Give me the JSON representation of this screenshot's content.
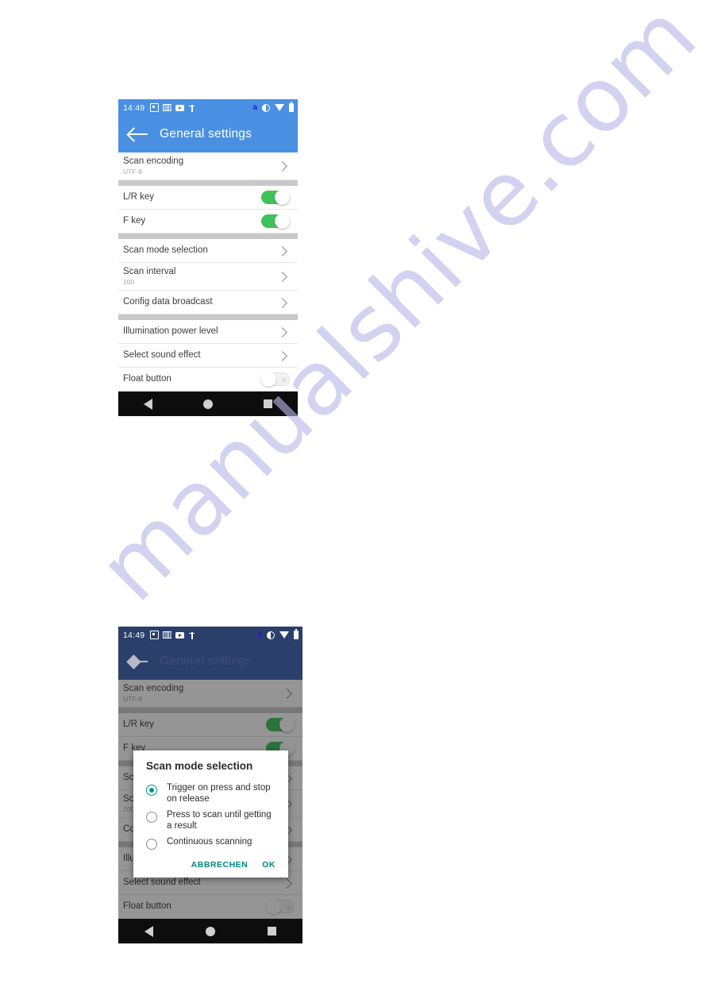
{
  "watermark": {
    "text": "manualshive.com"
  },
  "screens": [
    {
      "id": "general-settings",
      "status_bar": {
        "clock": "14:49",
        "left_icons": [
          "app-box-icon",
          "barcode-icon",
          "video-play-icon",
          "usb-icon"
        ],
        "right_icons": [
          "amazon-a-icon",
          "do-not-disturb-icon",
          "wifi-icon",
          "battery-icon"
        ]
      },
      "app_bar": {
        "back_icon": "back-arrow-icon",
        "title": "General settings"
      },
      "rows": [
        {
          "title": "Scan encoding",
          "subtitle": "UTF-8",
          "control": "chevron"
        },
        {
          "gap": true
        },
        {
          "title": "L/R key",
          "control": "toggle",
          "state": "on"
        },
        {
          "title": "F key",
          "control": "toggle",
          "state": "on"
        },
        {
          "gap": true
        },
        {
          "title": "Scan mode selection",
          "control": "chevron"
        },
        {
          "title": "Scan interval",
          "subtitle": "100",
          "control": "chevron"
        },
        {
          "title": "Config data broadcast",
          "control": "chevron"
        },
        {
          "gap": true
        },
        {
          "title": "Illumination power level",
          "control": "chevron"
        },
        {
          "title": "Select sound effect",
          "control": "chevron"
        },
        {
          "title": "Float button",
          "control": "toggle",
          "state": "off"
        }
      ],
      "nav_bar": [
        "back-triangle-icon",
        "home-circle-icon",
        "recents-square-icon"
      ]
    },
    {
      "id": "general-settings-with-dialog",
      "status_bar": {
        "clock": "14:49",
        "left_icons": [
          "app-box-icon",
          "barcode-icon",
          "video-play-icon",
          "usb-icon"
        ],
        "right_icons": [
          "amazon-a-icon",
          "do-not-disturb-icon",
          "wifi-icon",
          "battery-icon"
        ]
      },
      "app_bar": {
        "back_icon": "back-arrow-icon",
        "title": "General settings"
      },
      "rows": [
        {
          "title": "Scan encoding",
          "subtitle": "UTF-8",
          "control": "chevron"
        },
        {
          "gap": true
        },
        {
          "title": "L/R key",
          "control": "toggle",
          "state": "on"
        },
        {
          "title": "F key",
          "control": "toggle",
          "state": "on"
        },
        {
          "gap": true
        },
        {
          "title": "Scan mode selection",
          "control": "chevron"
        },
        {
          "title": "Scan interval",
          "subtitle": "100",
          "control": "chevron"
        },
        {
          "title": "Config data broadcast",
          "control": "chevron"
        },
        {
          "gap": true
        },
        {
          "title": "Illumination power level",
          "control": "chevron"
        },
        {
          "title": "Select sound effect",
          "control": "chevron"
        },
        {
          "title": "Float button",
          "control": "toggle",
          "state": "off"
        }
      ],
      "dialog": {
        "title": "Scan mode selection",
        "options": [
          {
            "label": "Trigger on press and stop on release",
            "selected": true
          },
          {
            "label": "Press to scan until getting a result",
            "selected": false
          },
          {
            "label": "Continuous scanning",
            "selected": false
          }
        ],
        "cancel_label": "ABBRECHEN",
        "ok_label": "OK",
        "accent_color": "#00897B"
      },
      "nav_bar": [
        "back-triangle-icon",
        "home-circle-icon",
        "recents-square-icon"
      ]
    }
  ],
  "colors": {
    "app_bar_blue": "#4A90E2",
    "app_bar_dim": "#2B3F6B",
    "toggle_on_green": "#3FC25B",
    "dialog_accent": "#00897B",
    "watermark_purple": "#B9B8E8"
  }
}
